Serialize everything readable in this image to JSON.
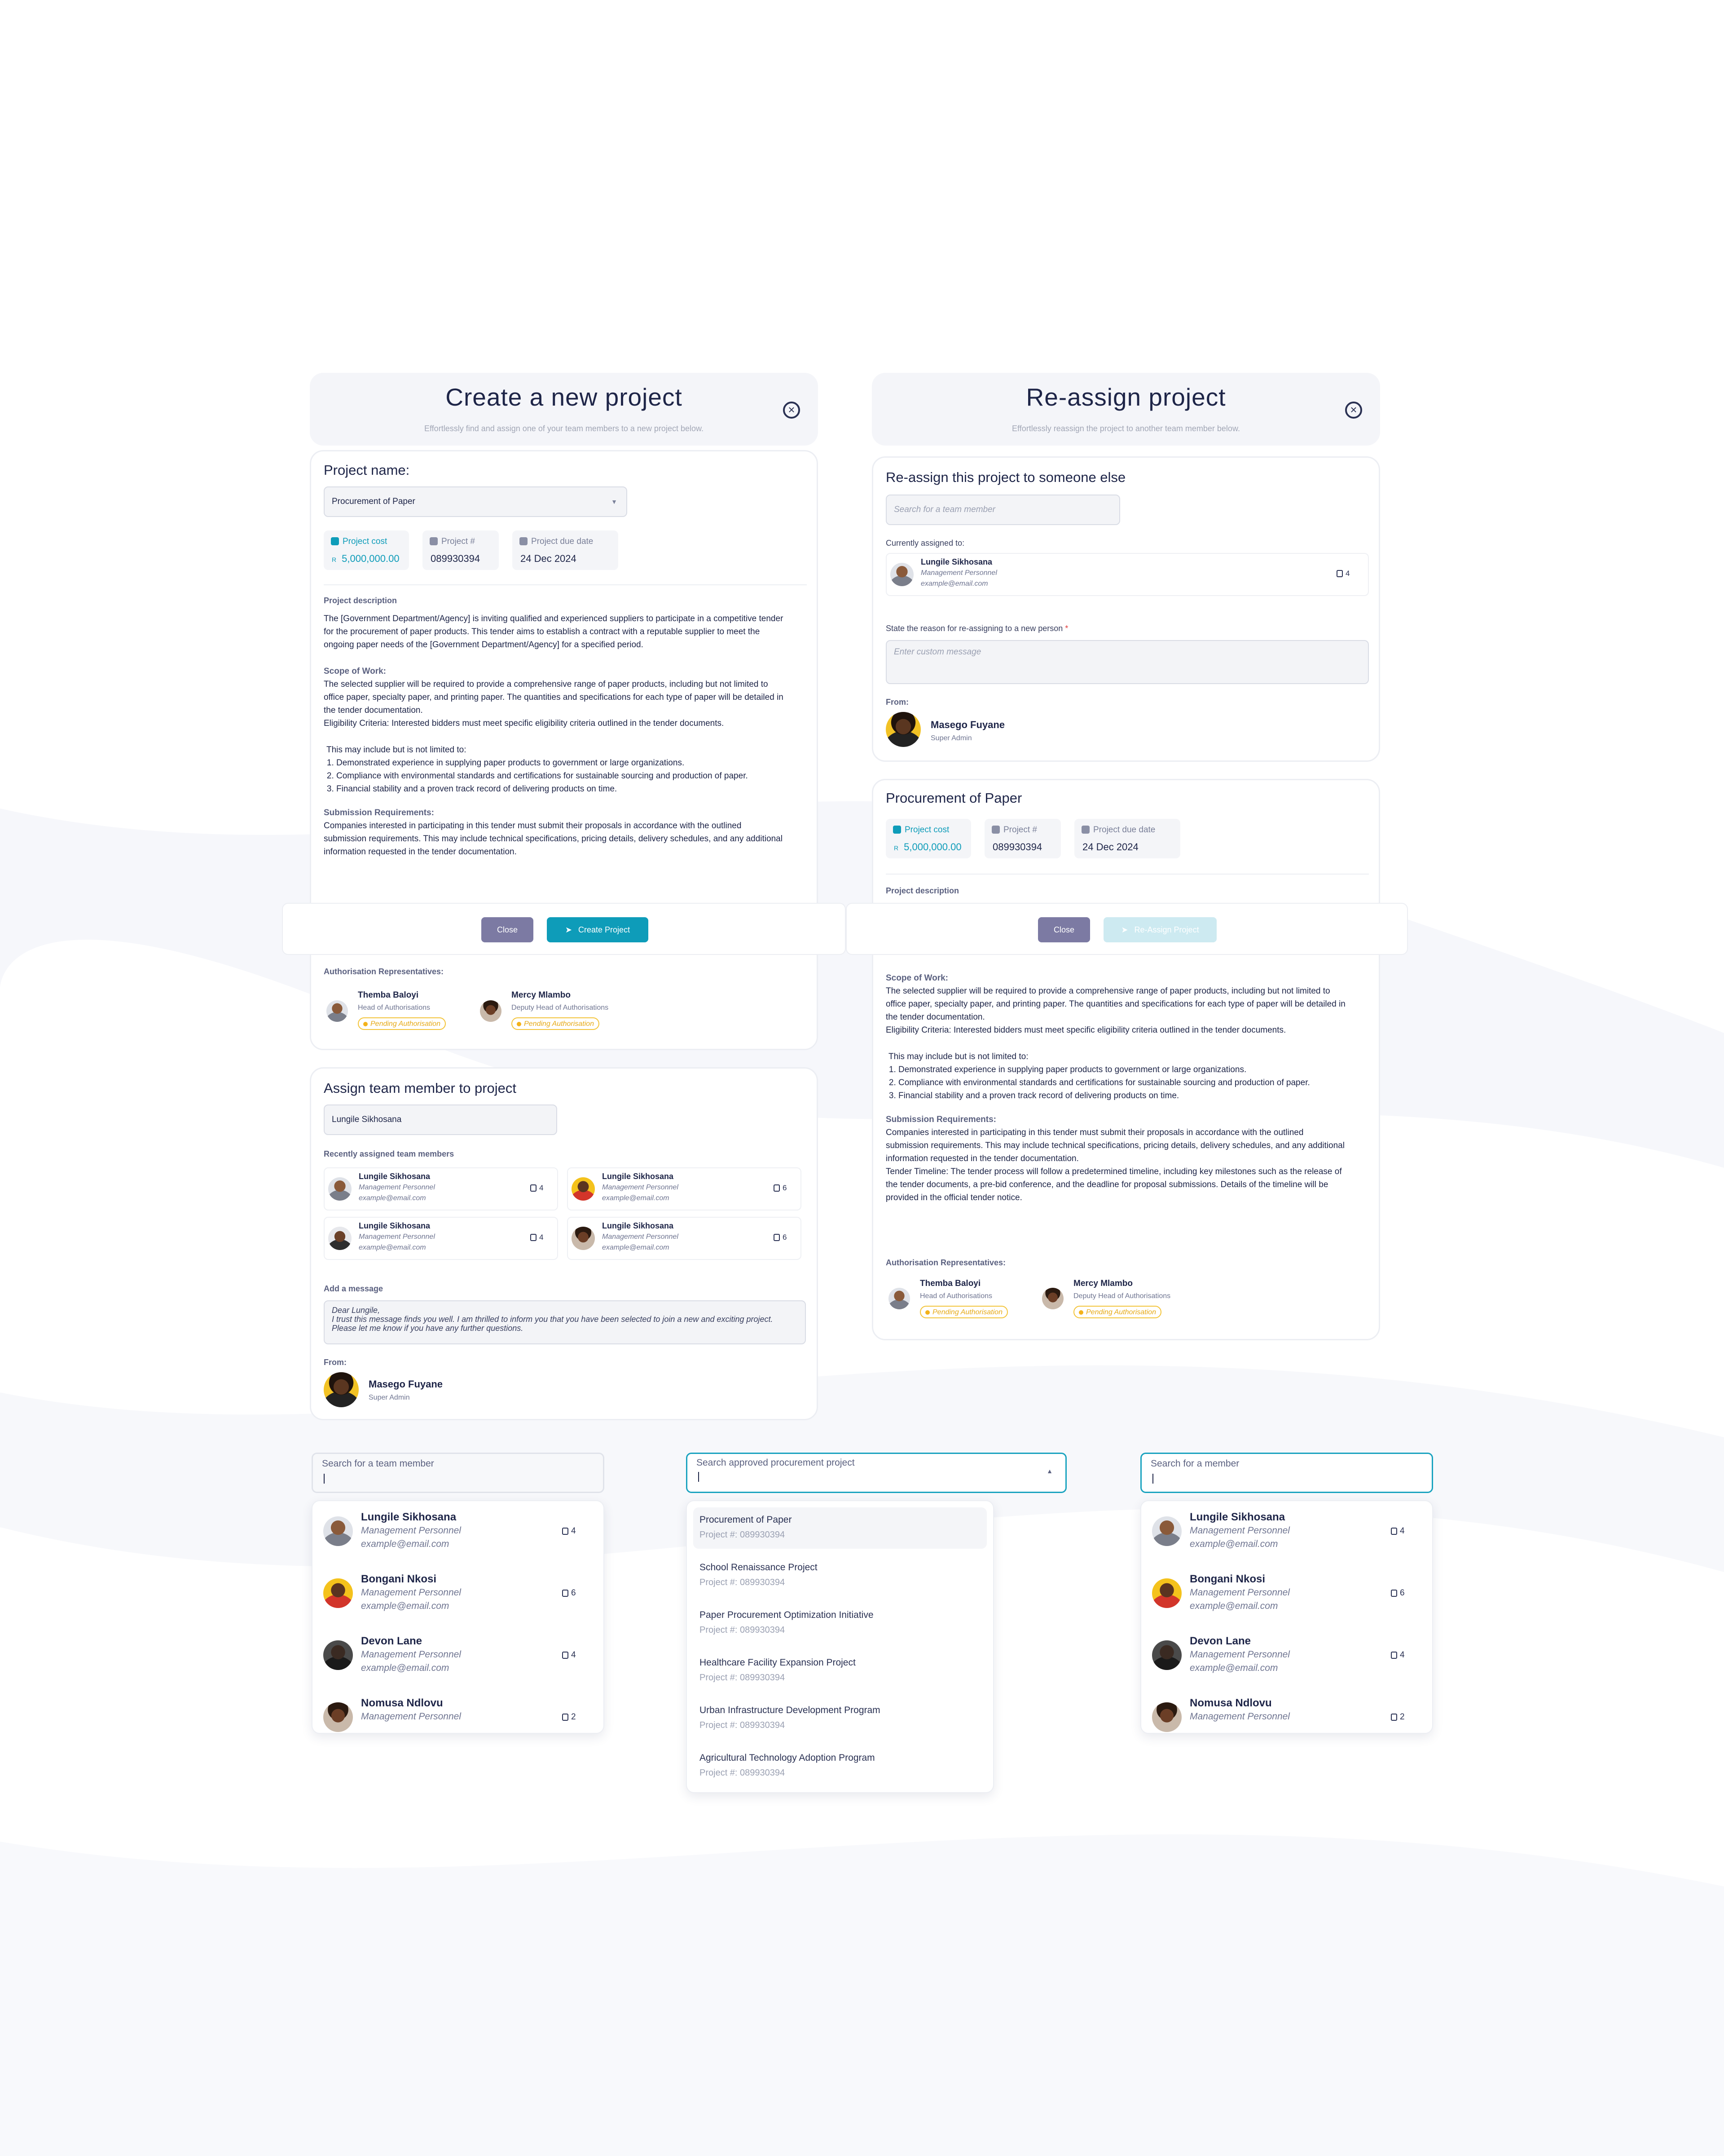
{
  "create": {
    "title": "Create a new project",
    "subtitle": "Effortlessly find and assign one of your team members to a new project below.",
    "project_name_label": "Project name:",
    "project_name_value": "Procurement of Paper",
    "cost_label": "Project cost",
    "cost_currency": "R",
    "cost_value": "5,000,000.00",
    "num_label": "Project #",
    "num_value": "089930394",
    "due_label": "Project due date",
    "due_value": "24 Dec 2024",
    "desc_label": "Project description",
    "desc_p1": "The [Government Department/Agency] is inviting qualified and experienced suppliers to participate in a competitive tender for the procurement of paper products. This tender aims to establish a contract with a reputable supplier to meet the ongoing paper needs of the [Government Department/Agency] for a specified period.",
    "scope_label": "Scope of Work:",
    "scope_text": "The selected supplier will be required to provide a comprehensive range of paper products, including but not limited to office paper, specialty paper, and printing paper. The quantities and specifications for each type of paper will be detailed in the tender documentation.",
    "elig_text": "Eligibility Criteria: Interested bidders must meet specific eligibility criteria outlined in the tender documents.",
    "may_include": "This may include but is not limited to:",
    "list": [
      "Demonstrated experience in supplying paper products to government or large organizations.",
      "Compliance with environmental standards and certifications for sustainable sourcing and production of paper.",
      "Financial stability and a proven track record of delivering products on time."
    ],
    "sub_label": "Submission Requirements:",
    "sub_text": "Companies interested in participating in this tender must submit their proposals in accordance with the outlined submission requirements. This may include technical specifications, pricing details, delivery schedules, and any additional information requested in the tender documentation.",
    "close_label": "Close",
    "create_label": "Create Project",
    "auth_label": "Authorisation Representatives:",
    "reps": [
      {
        "name": "Themba Baloyi",
        "role": "Head of Authorisations",
        "status": "Pending Authorisation"
      },
      {
        "name": "Mercy Mlambo",
        "role": "Deputy Head of Authorisations",
        "status": "Pending Authorisation"
      }
    ],
    "assign_title": "Assign team member to project",
    "assign_value": "Lungile Sikhosana",
    "recent_label": "Recently assigned team members",
    "recent": [
      {
        "name": "Lungile Sikhosana",
        "role": "Management Personnel",
        "email": "example@email.com",
        "count": "4"
      },
      {
        "name": "Lungile Sikhosana",
        "role": "Management Personnel",
        "email": "example@email.com",
        "count": "6"
      },
      {
        "name": "Lungile Sikhosana",
        "role": "Management Personnel",
        "email": "example@email.com",
        "count": "4"
      },
      {
        "name": "Lungile Sikhosana",
        "role": "Management Personnel",
        "email": "example@email.com",
        "count": "6"
      }
    ],
    "msg_label": "Add a message",
    "msg_line1": "Dear Lungile,",
    "msg_line2": "I trust this message finds you well. I am thrilled to inform you that you have been selected to join a new and exciting project. Please let me know if you have any further questions.",
    "from_label": "From:",
    "from_name": "Masego Fuyane",
    "from_role": "Super Admin"
  },
  "reassign": {
    "title": "Re-assign project",
    "subtitle": "Effortlessly reassign the project to another team member below.",
    "heading": "Re-assign this project to someone else",
    "search_placeholder": "Search for a team member",
    "current_label": "Currently assigned to:",
    "current": {
      "name": "Lungile Sikhosana",
      "role": "Management Personnel",
      "email": "example@email.com",
      "count": "4"
    },
    "reason_label": "State the reason for re-assigning to a new person",
    "required_mark": "*",
    "reason_placeholder": "Enter custom message",
    "from_label": "From:",
    "from_name": "Masego Fuyane",
    "from_role": "Super Admin",
    "project_title": "Procurement of Paper",
    "cost_label": "Project cost",
    "cost_currency": "R",
    "cost_value": "5,000,000.00",
    "num_label": "Project #",
    "num_value": "089930394",
    "due_label": "Project due date",
    "due_value": "24 Dec 2024",
    "desc_label": "Project description",
    "close_label": "Close",
    "reassign_label": "Re-Assign Project",
    "scope_label": "Scope of Work:",
    "scope_text": "The selected supplier will be required to provide a comprehensive range of paper products, including but not limited to office paper, specialty paper, and printing paper. The quantities and specifications for each type of paper will be detailed in the tender documentation.",
    "elig_text": "Eligibility Criteria: Interested bidders must meet specific eligibility criteria outlined in the tender documents.",
    "may_include": "This may include but is not limited to:",
    "list": [
      "Demonstrated experience in supplying paper products to government or large organizations.",
      "Compliance with environmental standards and certifications for sustainable sourcing and production of paper.",
      "Financial stability and a proven track record of delivering products on time."
    ],
    "sub_label": "Submission Requirements:",
    "sub_text": "Companies interested in participating in this tender must submit their proposals in accordance with the outlined submission requirements. This may include technical specifications, pricing details, delivery schedules, and any additional information requested in the tender documentation.",
    "timeline_text": "Tender Timeline: The tender process will follow a predetermined timeline, including key milestones such as the release of the tender documents, a pre-bid conference, and the deadline for proposal submissions. Details of the timeline will be provided in the official tender notice.",
    "auth_label": "Authorisation Representatives:",
    "reps": [
      {
        "name": "Themba Baloyi",
        "role": "Head of Authorisations",
        "status": "Pending Authorisation"
      },
      {
        "name": "Mercy Mlambo",
        "role": "Deputy Head of Authorisations",
        "status": "Pending Authorisation"
      }
    ]
  },
  "team_search": {
    "label": "Search for a team member",
    "members": [
      {
        "name": "Lungile Sikhosana",
        "role": "Management Personnel",
        "email": "example@email.com",
        "count": "4"
      },
      {
        "name": "Bongani Nkosi",
        "role": "Management Personnel",
        "email": "example@email.com",
        "count": "6"
      },
      {
        "name": "Devon Lane",
        "role": "Management Personnel",
        "email": "example@email.com",
        "count": "4"
      },
      {
        "name": "Nomusa Ndlovu",
        "role": "Management Personnel",
        "email": "",
        "count": "2"
      }
    ]
  },
  "project_search": {
    "label": "Search approved procurement project",
    "projects": [
      {
        "title": "Procurement of Paper",
        "number": "Project #: 089930394"
      },
      {
        "title": "School Renaissance Project",
        "number": "Project #: 089930394"
      },
      {
        "title": "Paper Procurement Optimization Initiative",
        "number": "Project #: 089930394"
      },
      {
        "title": "Healthcare Facility Expansion Project",
        "number": "Project #: 089930394"
      },
      {
        "title": "Urban Infrastructure Development Program",
        "number": "Project #: 089930394"
      },
      {
        "title": "Agricultural Technology Adoption Program",
        "number": "Project #: 089930394"
      }
    ]
  },
  "member_search": {
    "label": "Search for a member",
    "members": [
      {
        "name": "Lungile Sikhosana",
        "role": "Management Personnel",
        "email": "example@email.com",
        "count": "4"
      },
      {
        "name": "Bongani Nkosi",
        "role": "Management Personnel",
        "email": "example@email.com",
        "count": "6"
      },
      {
        "name": "Devon Lane",
        "role": "Management Personnel",
        "email": "example@email.com",
        "count": "4"
      },
      {
        "name": "Nomusa Ndlovu",
        "role": "Management Personnel",
        "email": "",
        "count": "2"
      }
    ]
  },
  "colors": {
    "accent": "#0e9cb9",
    "close_button": "#7c7aa3",
    "pending": "#f3b21a",
    "text": "#1e2548"
  }
}
